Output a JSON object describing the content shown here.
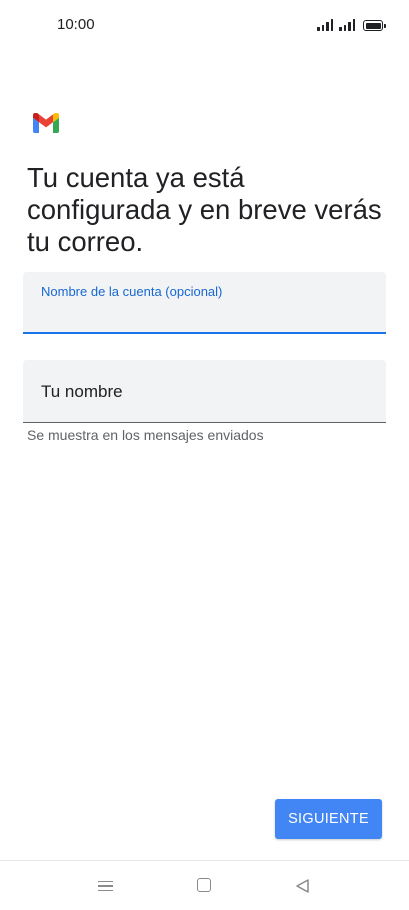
{
  "status_bar": {
    "time": "10:00",
    "signal_icons": [
      "signal-icon",
      "signal-icon"
    ],
    "battery_icon": "battery-icon"
  },
  "app": {
    "logo_icon": "gmail-logo-icon",
    "logo_colors": [
      "#EA4335",
      "#FBBC04",
      "#34A853",
      "#4285F4",
      "#C5221F"
    ]
  },
  "heading": "Tu cuenta ya está configurada y en breve verás tu correo.",
  "form": {
    "account_name": {
      "label": "Nombre de la cuenta (opcional)",
      "value": ""
    },
    "your_name": {
      "placeholder": "Tu nombre",
      "value": "",
      "helper": "Se muestra en los mensajes enviados"
    }
  },
  "actions": {
    "next_label": "SIGUIENTE",
    "accent_color": "#4285F4"
  },
  "nav_bar": {
    "icons": [
      "menu-icon",
      "home-icon",
      "back-icon"
    ]
  }
}
